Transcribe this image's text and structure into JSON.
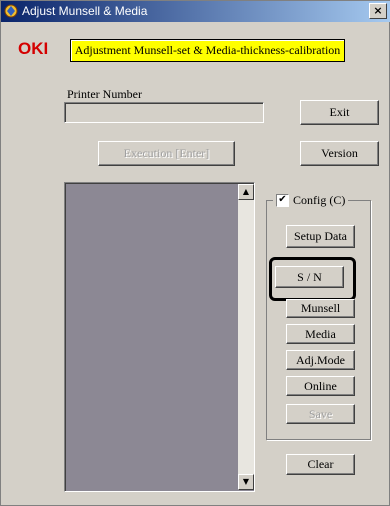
{
  "window": {
    "title": "Adjust Munsell & Media",
    "close_label": "×"
  },
  "header": {
    "logo": "OKI",
    "banner": "Adjustment Munsell-set & Media-thickness-calibration"
  },
  "printer": {
    "label": "Printer Number",
    "value": ""
  },
  "buttons": {
    "exit": "Exit",
    "version": "Version",
    "execution": "Execution [Enter]",
    "setup_data": "Setup Data",
    "sn": "S / N",
    "munsell": "Munsell",
    "media": "Media",
    "adj_mode": "Adj.Mode",
    "online": "Online",
    "save": "Save",
    "clear": "Clear"
  },
  "config": {
    "label": "Config (C)",
    "checked": true,
    "check_glyph": "✔"
  },
  "scroll": {
    "up": "▲",
    "down": "▼"
  }
}
